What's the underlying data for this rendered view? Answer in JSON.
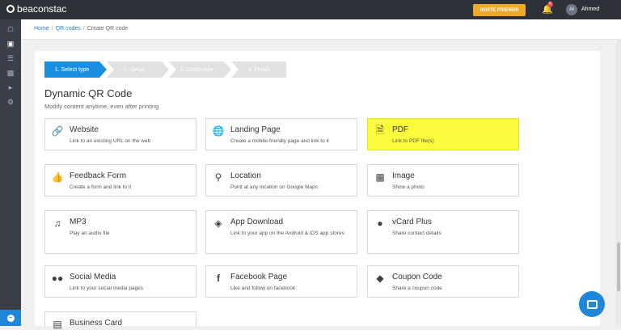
{
  "topbar": {
    "logo_text": "beaconstac",
    "invite_label": "INVITE FRIENDS",
    "notification_count": "8",
    "avatar_initials": "AI",
    "username": "Ahmed"
  },
  "breadcrumb": {
    "home": "Home",
    "qr_codes": "QR codes",
    "current": "Create QR code"
  },
  "steps": [
    {
      "label": "1. Select type"
    },
    {
      "label": "2. Setup"
    },
    {
      "label": "3. Customize"
    },
    {
      "label": "4. Finish"
    }
  ],
  "main": {
    "title": "Dynamic QR Code",
    "subtitle": "Modify content anytime, even after printing"
  },
  "cards": [
    {
      "name": "Website",
      "desc": "Link to an existing URL on the web",
      "icon": "link-icon"
    },
    {
      "name": "Landing Page",
      "desc": "Create a mobile-friendly page and link to it",
      "icon": "globe-icon"
    },
    {
      "name": "PDF",
      "desc": "Link to PDF file(s)",
      "icon": "pdf-icon"
    },
    {
      "name": "Feedback Form",
      "desc": "Create a form and link to it",
      "icon": "thumbs-up-icon"
    },
    {
      "name": "Location",
      "desc": "Point at any location on Google Maps",
      "icon": "map-marker-icon"
    },
    {
      "name": "Image",
      "desc": "Show a photo",
      "icon": "image-icon"
    },
    {
      "name": "MP3",
      "desc": "Play an audio file",
      "icon": "music-note-icon"
    },
    {
      "name": "App Download",
      "desc": "Link to your app on the Android & iOS app stores",
      "icon": "android-icon"
    },
    {
      "name": "vCard Plus",
      "desc": "Share contact details",
      "icon": "user-icon"
    },
    {
      "name": "Social Media",
      "desc": "Link to your social media pages",
      "icon": "users-icon"
    },
    {
      "name": "Facebook Page",
      "desc": "Like and follow on facebook",
      "icon": "facebook-icon"
    },
    {
      "name": "Coupon Code",
      "desc": "Share a coupon code",
      "icon": "tag-icon"
    },
    {
      "name": "Business Card",
      "desc": "",
      "icon": "card-icon"
    }
  ],
  "colors": {
    "accent": "#1a8fe0",
    "highlight": "#f9fb3c",
    "invite": "#f0a92a",
    "topbar": "#2d3138"
  }
}
